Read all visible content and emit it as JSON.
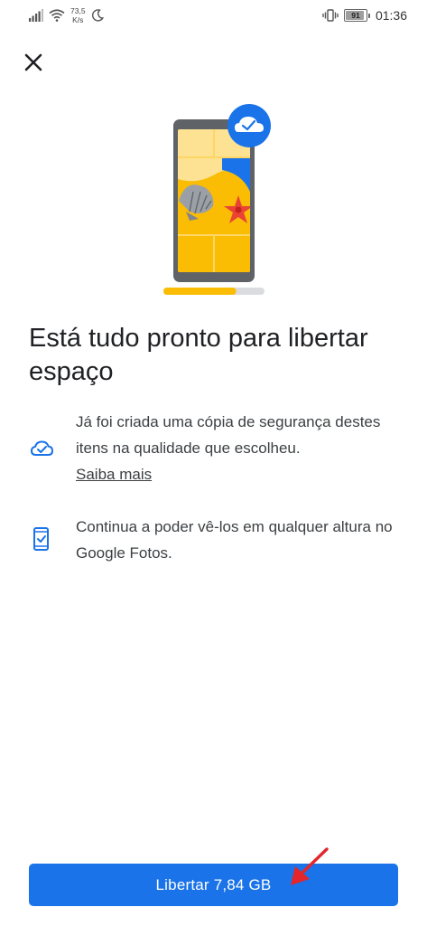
{
  "status_bar": {
    "network_speed_value": "73,5",
    "network_speed_unit": "K/s",
    "battery_level": "91",
    "battery_fraction": 0.91,
    "time": "01:36",
    "icons": [
      "signal-icon",
      "wifi-icon",
      "moon-icon",
      "vibrate-icon",
      "battery-icon"
    ]
  },
  "close": {
    "icon": "close-icon"
  },
  "illustration": {
    "badge_icon": "cloud-check-icon",
    "progress_fraction": 0.72,
    "colors": {
      "phone_frame": "#5f6368",
      "sand": "#fbbc04",
      "sand_light": "#fdd663",
      "water": "#1a73e8",
      "starfish": "#ea4335",
      "shell": "#9aa0a6",
      "badge": "#1a73e8",
      "track": "#dadce0"
    }
  },
  "title": "Está tudo pronto para libertar espaço",
  "info": [
    {
      "icon": "cloud-done-icon",
      "text": "Já foi criada uma cópia de segurança destes itens na qualidade que escolheu.",
      "link": "Saiba mais"
    },
    {
      "icon": "phone-check-icon",
      "text": "Continua a poder vê-los em qualquer altura no Google Fotos."
    }
  ],
  "primary_button": {
    "label": "Libertar 7,84 GB",
    "color": "#1a73e8"
  },
  "annotation": {
    "icon": "red-arrow-icon",
    "color": "#e3262b"
  }
}
